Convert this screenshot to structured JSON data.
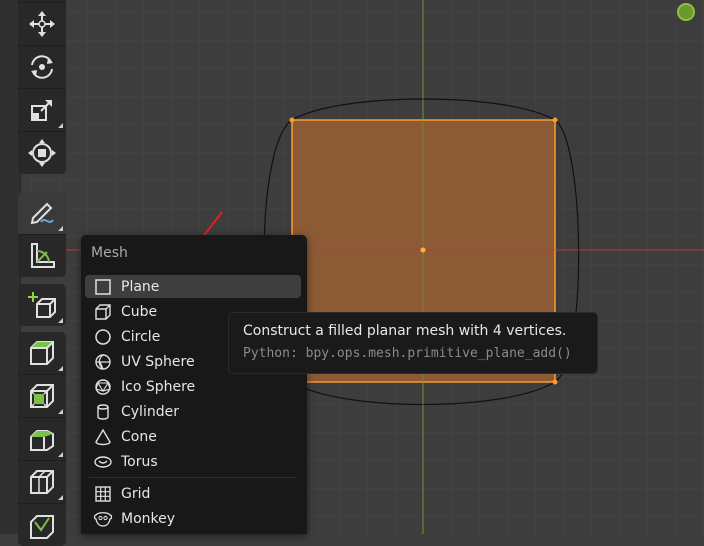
{
  "viewport": {
    "colors": {
      "background": "#3d3d3d",
      "x_axis": "#b33a3a",
      "y_axis": "#6a9a2c",
      "plane_fill": "#8c5a35",
      "plane_edge": "#ff9a2a",
      "annotation_arrow": "#e02020"
    }
  },
  "toolbar": {
    "tools": [
      {
        "name": "move",
        "icon": "move-icon"
      },
      {
        "name": "rotate",
        "icon": "rotate-icon"
      },
      {
        "name": "scale",
        "icon": "scale-icon"
      },
      {
        "name": "transform",
        "icon": "transform-icon"
      },
      {
        "name": "annotate",
        "icon": "annotate-icon"
      },
      {
        "name": "measure",
        "icon": "measure-icon"
      },
      {
        "name": "add-cube",
        "icon": "add-cube-icon"
      },
      {
        "name": "extrude",
        "icon": "extrude-icon"
      },
      {
        "name": "inset",
        "icon": "inset-icon"
      },
      {
        "name": "bevel",
        "icon": "bevel-icon"
      },
      {
        "name": "loop-cut",
        "icon": "loop-cut-icon"
      },
      {
        "name": "knife",
        "icon": "knife-icon"
      }
    ]
  },
  "menu": {
    "title": "Mesh",
    "items": [
      {
        "label": "Plane",
        "icon": "plane-icon"
      },
      {
        "label": "Cube",
        "icon": "cube-icon"
      },
      {
        "label": "Circle",
        "icon": "circle-icon"
      },
      {
        "label": "UV Sphere",
        "icon": "uv-sphere-icon"
      },
      {
        "label": "Ico Sphere",
        "icon": "ico-sphere-icon"
      },
      {
        "label": "Cylinder",
        "icon": "cylinder-icon"
      },
      {
        "label": "Cone",
        "icon": "cone-icon"
      },
      {
        "label": "Torus",
        "icon": "torus-icon"
      },
      {
        "label": "Grid",
        "icon": "grid-icon"
      },
      {
        "label": "Monkey",
        "icon": "monkey-icon"
      }
    ]
  },
  "tooltip": {
    "description": "Construct a filled planar mesh with 4 vertices.",
    "python": "Python: bpy.ops.mesh.primitive_plane_add()"
  }
}
